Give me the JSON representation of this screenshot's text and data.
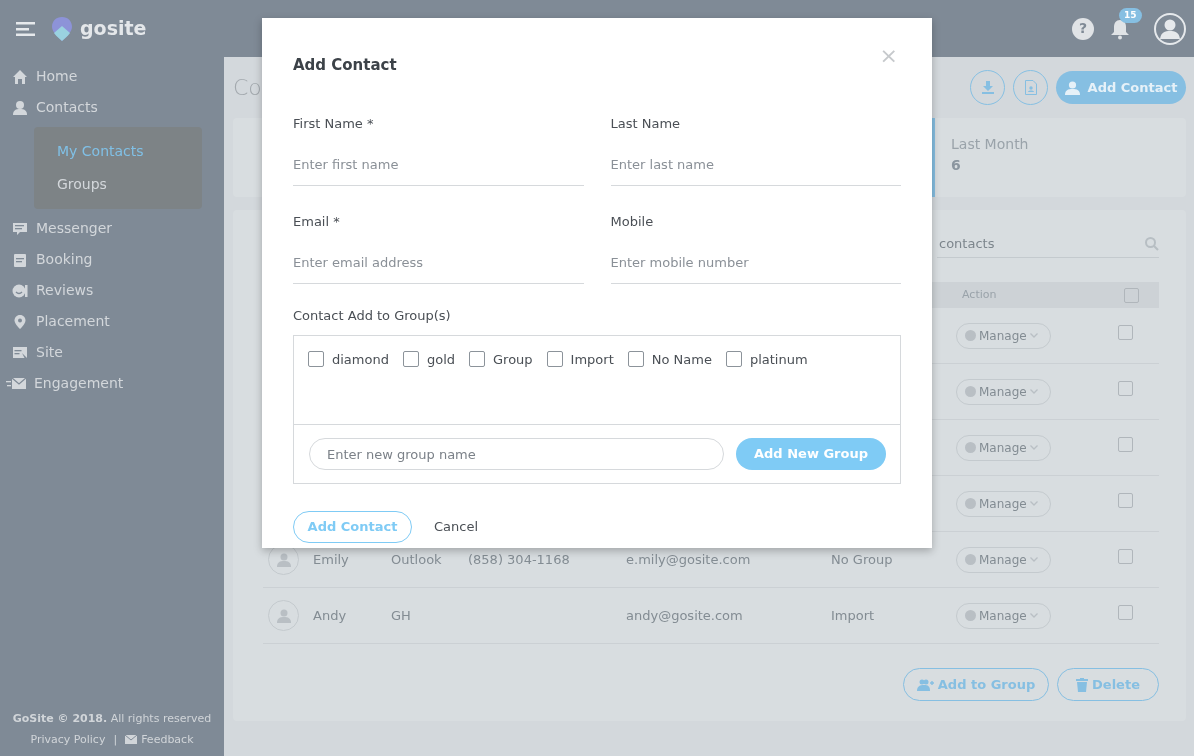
{
  "header": {
    "logo_text": "gosite",
    "help": "?",
    "notification_count": "15"
  },
  "sidebar": {
    "items": [
      {
        "label": "Home"
      },
      {
        "label": "Contacts",
        "expanded": true,
        "children": [
          {
            "label": "My Contacts",
            "selected": true
          },
          {
            "label": "Groups",
            "selected": false
          }
        ]
      },
      {
        "label": "Messenger"
      },
      {
        "label": "Booking"
      },
      {
        "label": "Reviews"
      },
      {
        "label": "Placement"
      },
      {
        "label": "Site"
      },
      {
        "label": "Engagement"
      }
    ],
    "footer": {
      "copyright": "**GoSite © 2018.** All rights reserved",
      "links": [
        "Privacy Policy",
        "Feedback"
      ],
      "separator": "|"
    }
  },
  "page": {
    "title": "Co",
    "add_button": "Add Contact"
  },
  "stats": [
    {
      "label": "Last Month",
      "value": "6"
    }
  ],
  "search": {
    "placeholder": "contacts"
  },
  "table": {
    "columns": [
      "Action"
    ],
    "select_all_checked": false,
    "rows": [
      {
        "action": "Manage",
        "checked": false
      },
      {
        "action": "Manage",
        "checked": false
      },
      {
        "action": "Manage",
        "checked": false
      },
      {
        "action": "Manage",
        "checked": false
      },
      {
        "first_name": "Emily",
        "last_name": "Outlook",
        "phone": "(858) 304-1168",
        "email": "e.mily@gosite.com",
        "group": "No Group",
        "action": "Manage",
        "checked": false
      },
      {
        "first_name": "Andy",
        "last_name": "GH",
        "email": "andy@gosite.com",
        "group": "Import",
        "action": "Manage",
        "checked": false
      }
    ]
  },
  "bulk_buttons": [
    "Add to Group",
    "Delete"
  ],
  "modal": {
    "title": "Add Contact",
    "close": "×",
    "fields": [
      {
        "label": "First Name *",
        "placeholder": "Enter first name"
      },
      {
        "label": "Last Name",
        "placeholder": "Enter last name"
      },
      {
        "label": "Email *",
        "placeholder": "Enter email address"
      },
      {
        "label": "Mobile",
        "placeholder": "Enter mobile number"
      }
    ],
    "groups_label": "Contact Add to Group(s)",
    "groups": [
      {
        "label": "diamond",
        "checked": false
      },
      {
        "label": "gold",
        "checked": false
      },
      {
        "label": "Group",
        "checked": false
      },
      {
        "label": "Import",
        "checked": false
      },
      {
        "label": "No Name",
        "checked": false
      },
      {
        "label": "platinum",
        "checked": false
      }
    ],
    "new_group": {
      "placeholder": "Enter new group name",
      "button": "Add New Group"
    },
    "submit": "Add Contact",
    "cancel": "Cancel"
  }
}
